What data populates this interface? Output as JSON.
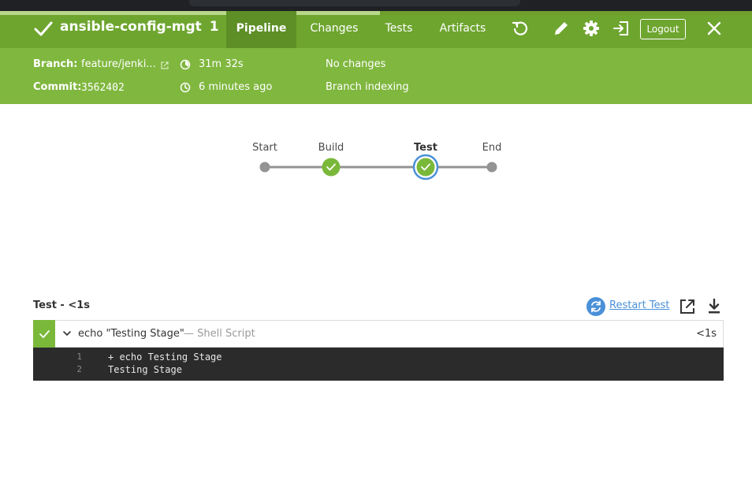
{
  "colors": {
    "header": "#6ea52f",
    "tab_active": "#5d8f26",
    "subbar": "#80b73f",
    "success": "#7ab83a",
    "selected_ring": "#4a90d9",
    "log_bg": "#2b2b2b"
  },
  "header": {
    "status_icon": "check-icon",
    "pipeline_name": "ansible-config-mgt",
    "run_number": "1",
    "tabs": [
      {
        "label": "Pipeline",
        "active": true
      },
      {
        "label": "Changes",
        "active": false
      },
      {
        "label": "Tests",
        "active": false
      },
      {
        "label": "Artifacts",
        "active": false
      }
    ],
    "actions": [
      "replay-icon",
      "edit-icon",
      "settings-gear-icon",
      "sign-out-icon"
    ],
    "logout_label": "Logout",
    "close_icon": "close-icon"
  },
  "progress": 0.505,
  "run_info": {
    "branch_label": "Branch:",
    "branch_value": "feature/jenki...",
    "commit_label": "Commit:",
    "commit_value": "3562402",
    "duration": "31m 32s",
    "started": "6 minutes ago",
    "changes": "No changes",
    "cause": "Branch indexing"
  },
  "pipeline": {
    "stages": [
      {
        "name": "Start",
        "status": "node",
        "selected": false
      },
      {
        "name": "Build",
        "status": "success",
        "selected": false
      },
      {
        "name": "Test",
        "status": "success",
        "selected": true
      },
      {
        "name": "End",
        "status": "node",
        "selected": false
      }
    ]
  },
  "stage_detail": {
    "title": "Test - <1s",
    "restart_label": "Restart Test",
    "step": {
      "name": "echo \"Testing Stage\"",
      "type": "— Shell Script",
      "duration": "<1s"
    },
    "log": [
      {
        "num": "1",
        "text": "+ echo Testing Stage"
      },
      {
        "num": "2",
        "text": "Testing Stage"
      }
    ]
  }
}
